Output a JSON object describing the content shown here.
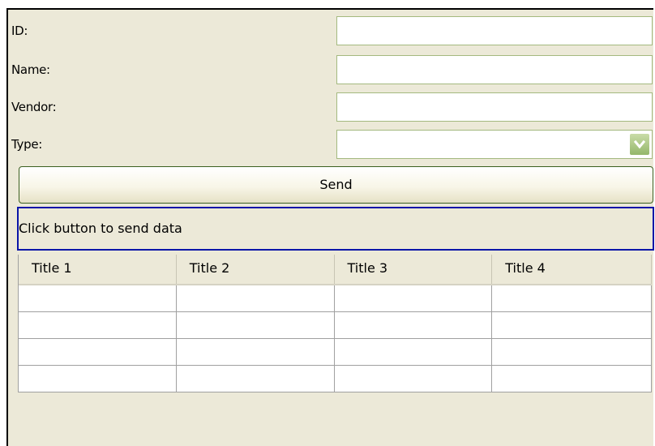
{
  "form": {
    "id_label": "ID:",
    "id_value": "",
    "name_label": "Name:",
    "name_value": "",
    "vendor_label": "Vendor:",
    "vendor_value": "",
    "type_label": "Type:",
    "type_value": ""
  },
  "send_button": {
    "label": "Send"
  },
  "status": {
    "text": "Click button to send data"
  },
  "table": {
    "columns": [
      "Title 1",
      "Title 2",
      "Title 3",
      "Title 4"
    ],
    "rows": [
      [
        "",
        "",
        "",
        ""
      ],
      [
        "",
        "",
        "",
        ""
      ],
      [
        "",
        "",
        "",
        ""
      ],
      [
        "",
        "",
        "",
        ""
      ]
    ]
  },
  "icons": {
    "combo_arrow": "chevron-down-icon"
  },
  "colors": {
    "window_bg": "#ece9d8",
    "field_border": "#a4b97f",
    "status_border": "#0a15a8",
    "button_border": "#3c6021",
    "combo_arrow": "#94b76a"
  }
}
